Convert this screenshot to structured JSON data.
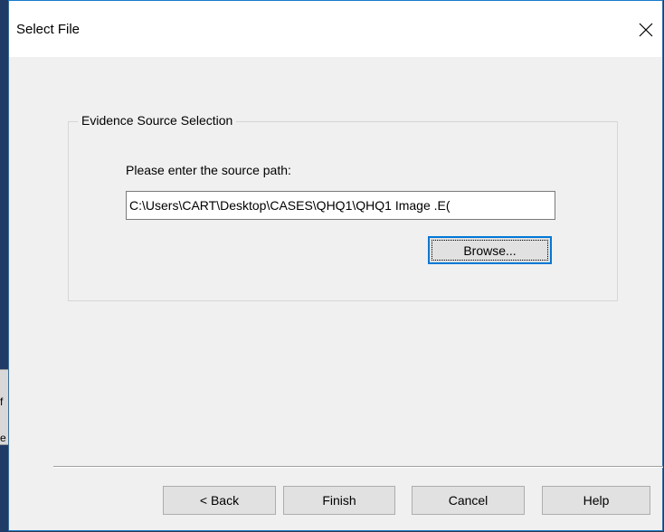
{
  "background": {
    "fragment_top": "f",
    "fragment_bottom": "e"
  },
  "dialog": {
    "title": "Select File",
    "close_icon": "close-icon",
    "group": {
      "legend": "Evidence Source Selection",
      "prompt": "Please enter the source path:",
      "path_value": "C:\\Users\\CART\\Desktop\\CASES\\QHQ1\\QHQ1 Image .E(",
      "browse_label": "Browse..."
    },
    "buttons": {
      "back": "< Back",
      "finish": "Finish",
      "cancel": "Cancel",
      "help": "Help"
    }
  },
  "colors": {
    "accent": "#0078d7",
    "window_border": "#1979ca",
    "dialog_bg": "#f0f0f0"
  }
}
